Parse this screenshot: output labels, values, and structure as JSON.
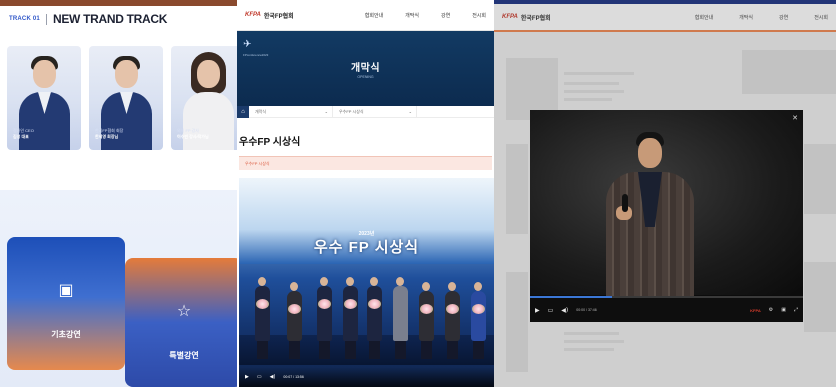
{
  "panel1": {
    "track_no": "TRACK 01",
    "track_title": "NEW TRAND TRACK",
    "speakers": [
      {
        "role": "정가인 CEO",
        "name": "김성 대표"
      },
      {
        "role": "한국FP협회 회장",
        "name": "한세영 회장님"
      },
      {
        "role": "외식 FP 강사",
        "name": "이수빈 강사/작가님"
      }
    ],
    "cards": [
      {
        "label": "기초강연",
        "icon": "play-screen-icon"
      },
      {
        "label": "특별강연",
        "icon": "star-hand-icon"
      }
    ]
  },
  "panel2": {
    "logo_mark": "KFPA",
    "logo_name": "한국FP협회",
    "menu": [
      "협회안내",
      "개막식",
      "강연",
      "전시회"
    ],
    "hero_emblem_text": "FPconference2023",
    "hero_title": "개막식",
    "hero_sub": "OPENING",
    "breadcrumb": [
      "개막식",
      "우수FP 시상식"
    ],
    "page_title": "우수FP 시상식",
    "notice": "우수FP 시상식",
    "banner_year": "2023년",
    "banner_title": "우수 FP 시상식",
    "player_time": "00:07 / 13:56"
  },
  "panel3": {
    "logo_mark": "KFPA",
    "logo_name": "한국FP협회",
    "menu": [
      "협회안내",
      "개막식",
      "강연",
      "전시회"
    ],
    "player_time": "00:00 / 37:46",
    "player_brand": "KFPA"
  },
  "colors": {
    "accent_blue": "#2f56c8",
    "kfpa_red": "#c0392b",
    "hero_navy": "#123a63",
    "notice_red": "#d9563a",
    "progress_blue": "#3b77d6"
  }
}
